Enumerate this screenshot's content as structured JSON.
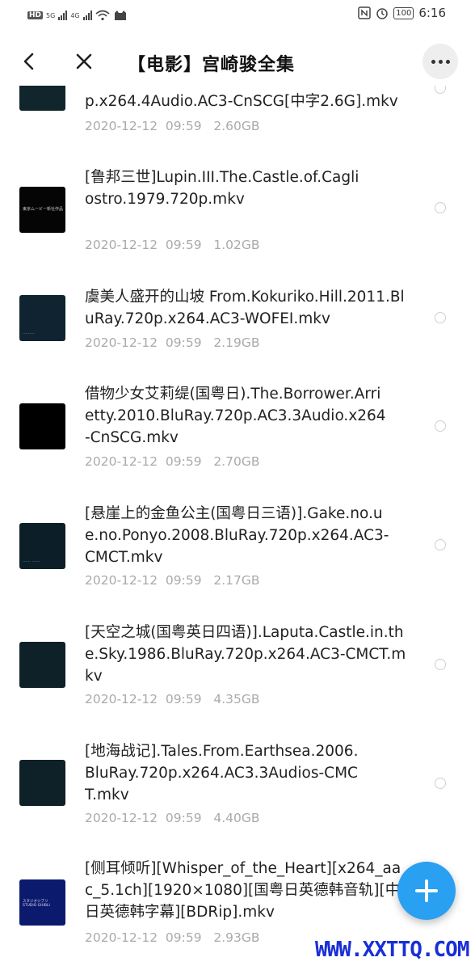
{
  "status_bar": {
    "left_badges": [
      "HD",
      "HD"
    ],
    "network_1": "5G",
    "network_2": "4G",
    "battery": "100",
    "time": "6:16",
    "icons": [
      "nfc-icon",
      "alarm-icon",
      "wifi-icon",
      "cat-icon"
    ]
  },
  "header": {
    "title": "【电影】宫崎骏全集"
  },
  "files": [
    {
      "name": "p.x264.4Audio.AC3-CnSCG[中字2.6G].mkv",
      "date": "2020-12-12  09:59",
      "size": "2.60GB",
      "thumb": "#10252c"
    },
    {
      "name": "[鲁邦三世]Lupin.III.The.Castle.of.Cagliostro.1979.720p.mkv",
      "date": "2020-12-12  09:59",
      "size": "1.02GB",
      "thumb": "#050505",
      "thumb_text": "東京ムービー新社作品"
    },
    {
      "name": "虞美人盛开的山坡 From.Kokuriko.Hill.2011.BluRay.720p.x264.AC3-WOFEI.mkv",
      "date": "2020-12-12  09:59",
      "size": "2.19GB",
      "thumb": "#0f2430"
    },
    {
      "name": "借物少女艾莉缇(国粤日).The.Borrower.Arrietty.2010.BluRay.720p.AC3.3Audio.x264-CnSCG.mkv",
      "date": "2020-12-12  09:59",
      "size": "2.70GB",
      "thumb": "#000000"
    },
    {
      "name": "[悬崖上的金鱼公主(国粤日三语)].Gake.no.ue.no.Ponyo.2008.BluRay.720p.x264.AC3-CMCT.mkv",
      "date": "2020-12-12  09:59",
      "size": "2.17GB",
      "thumb": "#0c1f28"
    },
    {
      "name": "[天空之城(国粤英日四语)].Laputa.Castle.in.the.Sky.1986.BluRay.720p.x264.AC3-CMCT.mkv",
      "date": "2020-12-12  09:59",
      "size": "4.35GB",
      "thumb": "#0e2129"
    },
    {
      "name": "[地海战记].Tales.From.Earthsea.2006.BluRay.720p.x264.AC3.3Audios-CMCT.mkv",
      "date": "2020-12-12  09:59",
      "size": "4.40GB",
      "thumb": "#0e2028"
    },
    {
      "name": "[侧耳倾听][Whisper_of_the_Heart][x264_aac_5.1ch][1920×1080][国粤日英德韩音轨][中日英德韩字幕][BDRip].mkv",
      "date": "2020-12-12  09:59",
      "size": "2.93GB",
      "thumb": "#0c1a6e",
      "thumb_text": "スタジオジブリ STUDIO GHIBLI"
    }
  ],
  "watermark": "WWW.XXTTQ.COM",
  "colors": {
    "accent": "#29a0f2",
    "meta": "#aaaaaa",
    "watermark": "#1a2fd6"
  }
}
